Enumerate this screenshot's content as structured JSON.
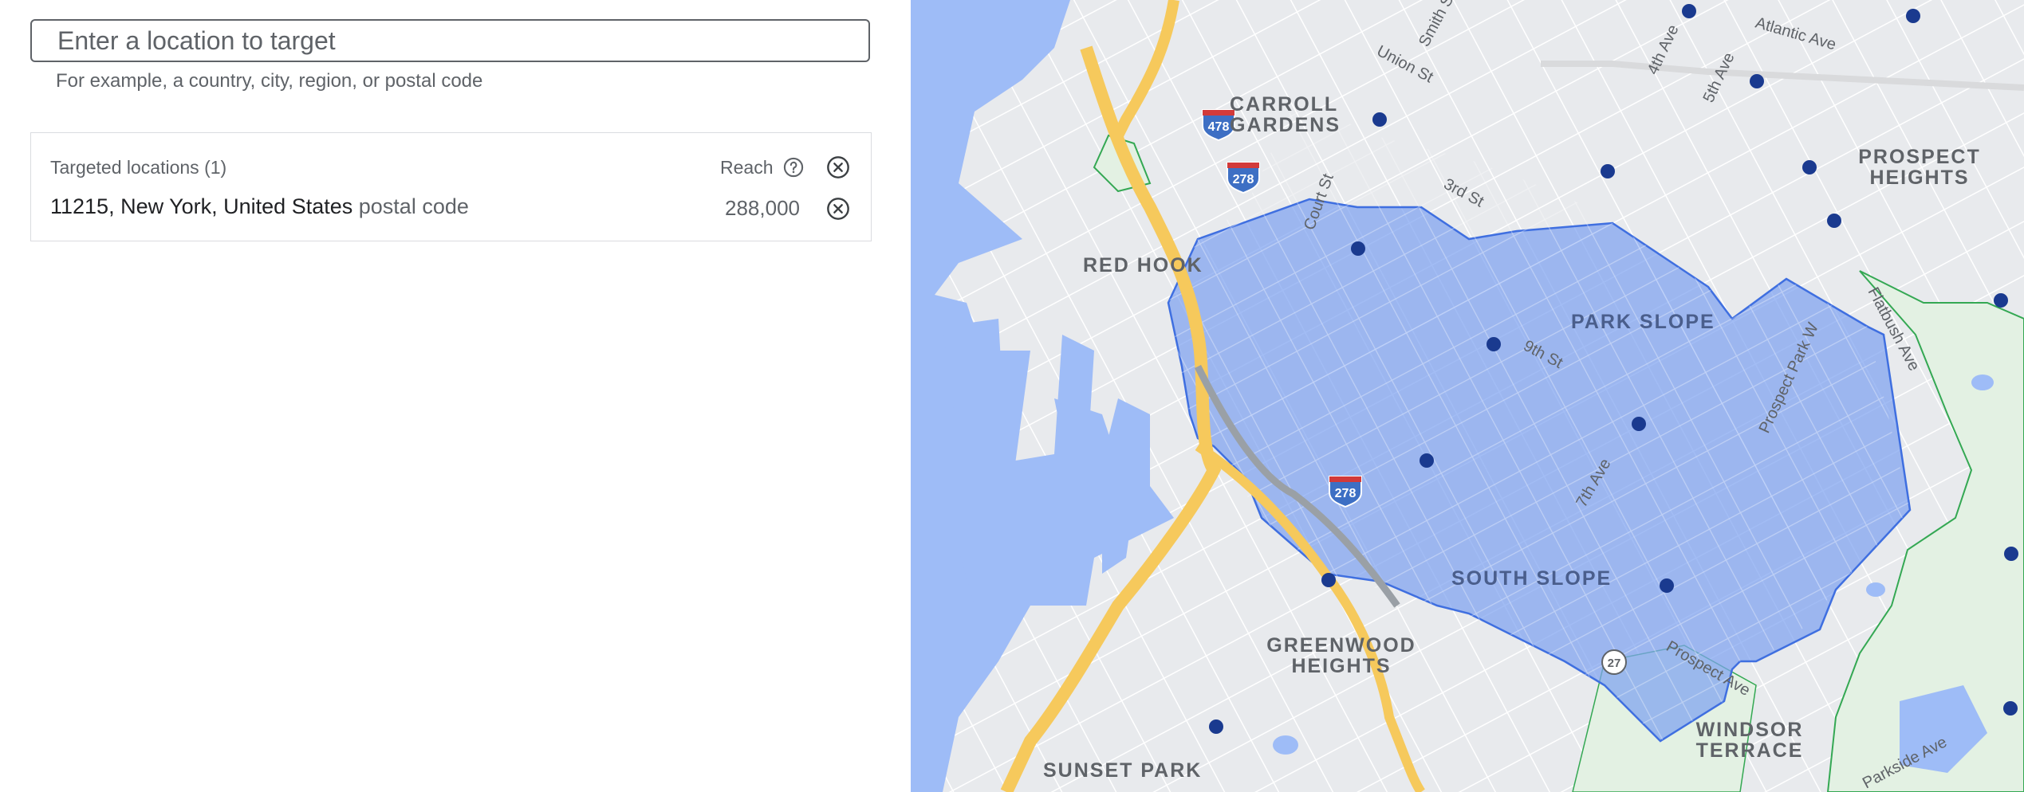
{
  "search": {
    "placeholder": "Enter a location to target",
    "helper": "For example, a country, city, region, or postal code"
  },
  "targeted": {
    "header": "Targeted locations (1)",
    "reach_label": "Reach",
    "items": [
      {
        "name": "11215, New York, United States",
        "type": "postal code",
        "reach": "288,000"
      }
    ]
  },
  "map": {
    "neighborhoods": [
      "CARROLL GARDENS",
      "RED HOOK",
      "PARK SLOPE",
      "SOUTH SLOPE",
      "GREENWOOD HEIGHTS",
      "SUNSET PARK",
      "WINDSOR TERRACE",
      "PROSPECT HEIGHTS"
    ],
    "streets": [
      "Atlantic Ave",
      "Union St",
      "4th Ave",
      "5th Ave",
      "Court St",
      "3rd St",
      "9th St",
      "7th Ave",
      "Prospect Park W",
      "Flatbush Ave",
      "Prospect Ave",
      "Parkside Ave",
      "Smith St"
    ],
    "highway_shields": [
      "478",
      "278",
      "278",
      "27"
    ],
    "colors": {
      "water": "#9ebcf7",
      "highway": "#f6c95c",
      "highlight": "#7ea2f0",
      "park": "#e3f1e3"
    }
  }
}
